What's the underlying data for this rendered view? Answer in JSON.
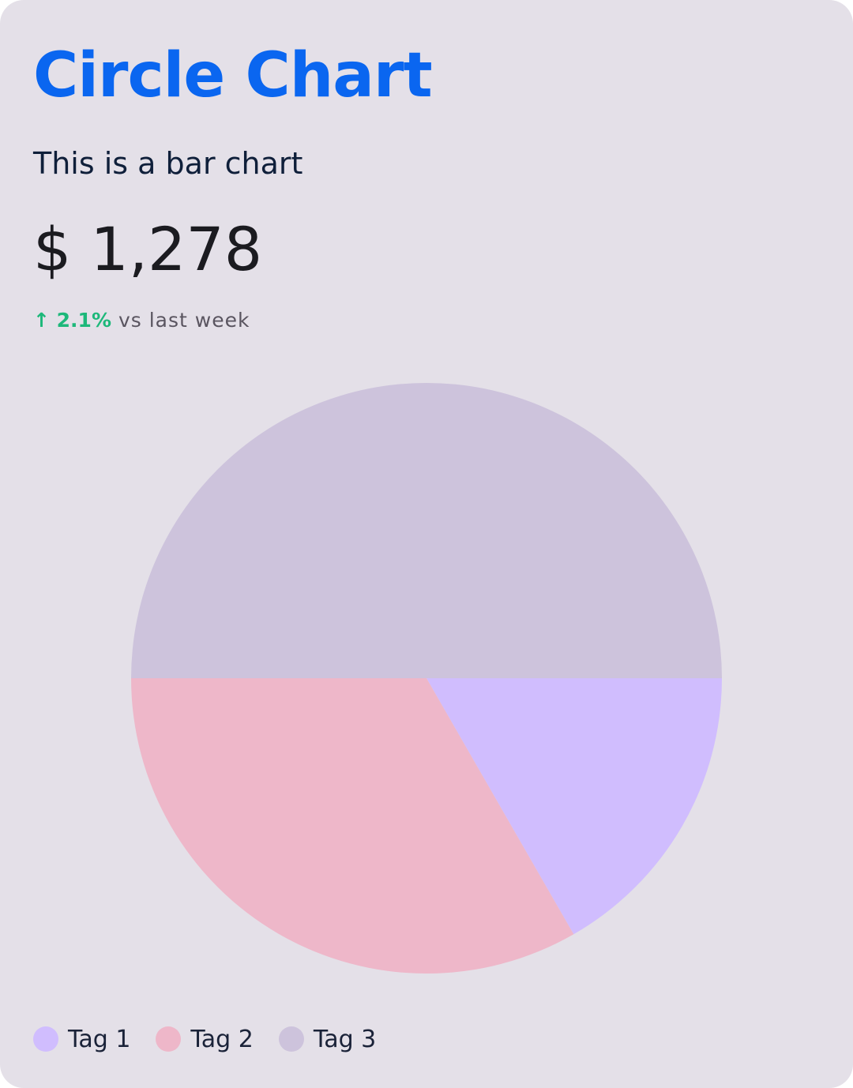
{
  "card": {
    "title": "Circle Chart",
    "subtitle": "This is a bar chart",
    "amount": "$ 1,278",
    "delta": {
      "arrow_value": "↑ 2.1%",
      "text": " vs last week"
    }
  },
  "colors": {
    "title": "#0a66f0",
    "positive": "#1db87a",
    "background": "#e4e0e8"
  },
  "chart_data": {
    "type": "pie",
    "slices": [
      {
        "label": "Tag 1",
        "value": 16.7,
        "color": "#d0bdfe"
      },
      {
        "label": "Tag 2",
        "value": 33.3,
        "color": "#eeb7c9"
      },
      {
        "label": "Tag 3",
        "value": 50.0,
        "color": "#cdc3dc"
      }
    ],
    "legend": "bottom-left",
    "start": "3 o'clock, clockwise"
  }
}
